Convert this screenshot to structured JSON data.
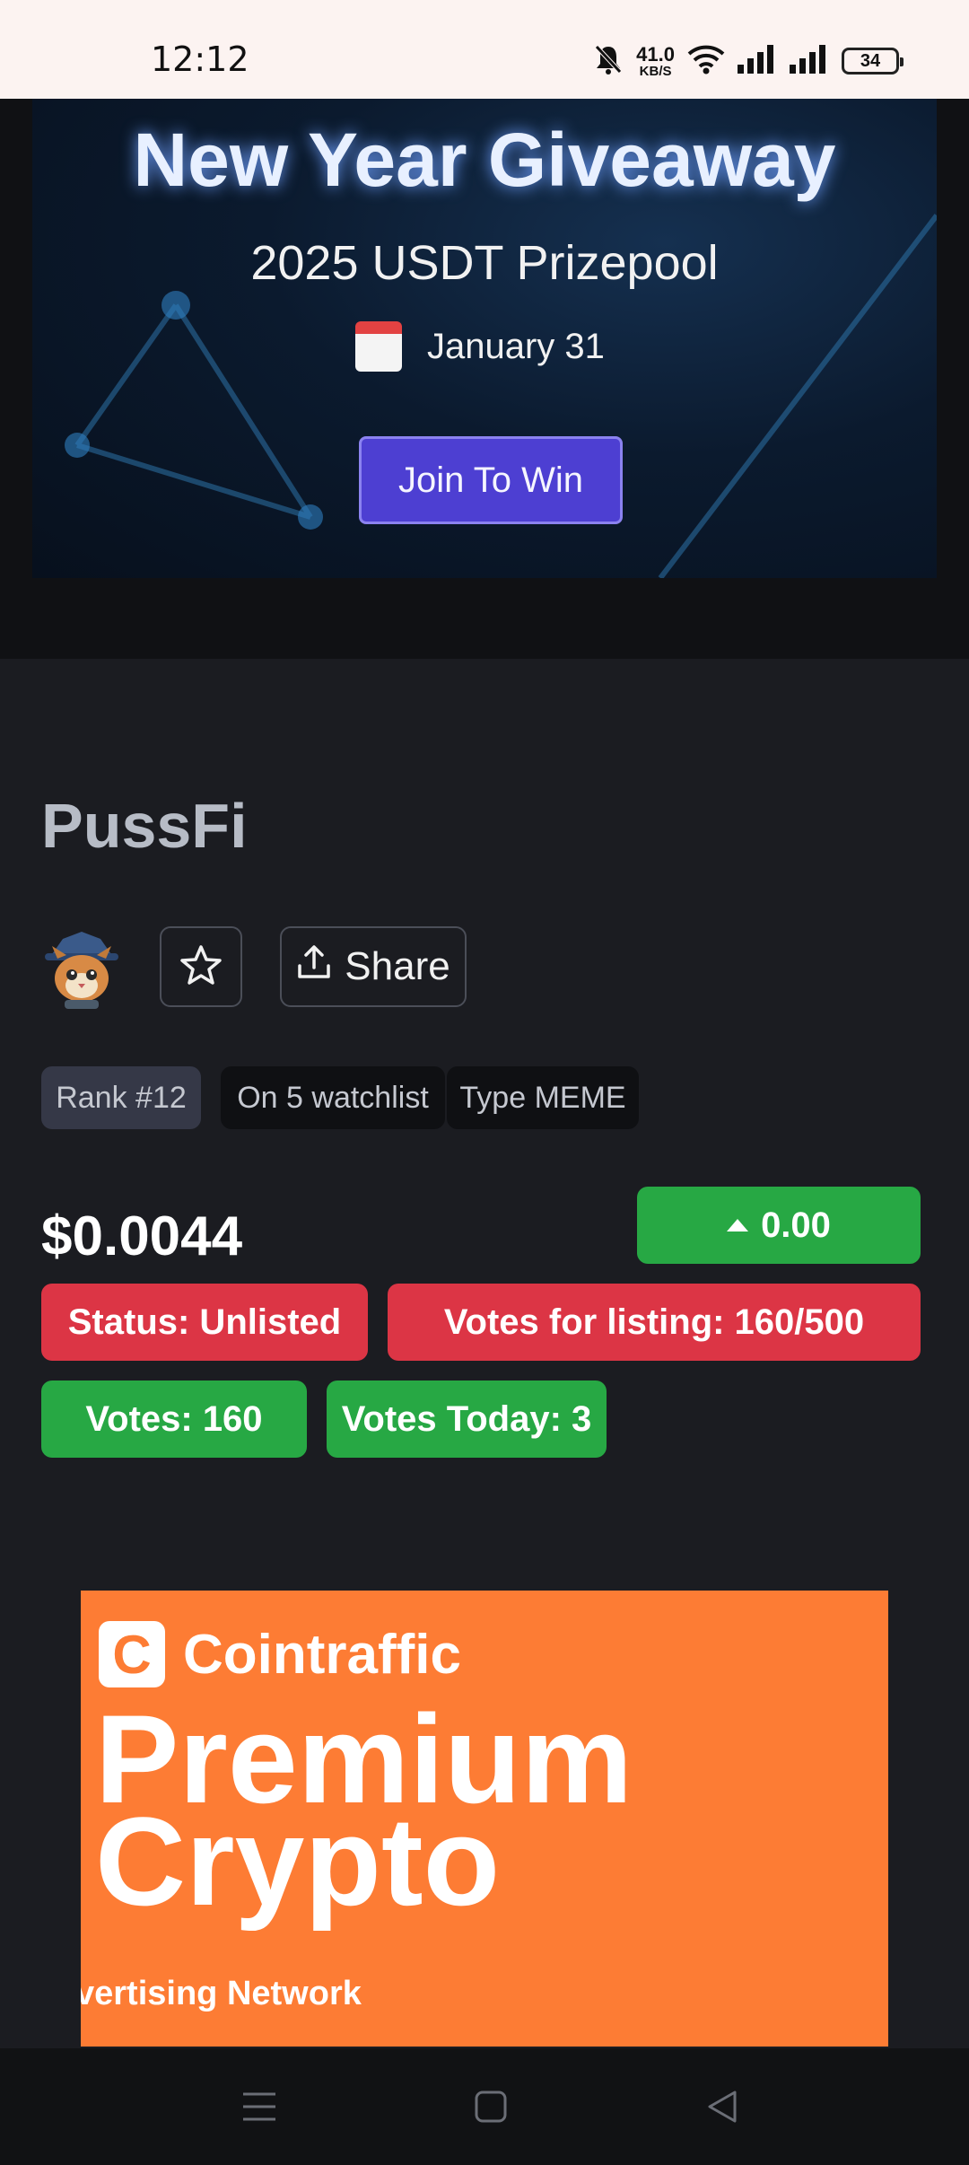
{
  "status_bar": {
    "time": "12:12",
    "net_speed": "41.0",
    "net_unit": "KB/S",
    "battery": "34"
  },
  "banner": {
    "title": "New Year Giveaway",
    "subtitle": "2025 USDT Prizepool",
    "date": "January 31",
    "button": "Join To Win"
  },
  "token": {
    "name": "PussFi",
    "share_label": "Share",
    "chips": {
      "rank": "Rank #12",
      "watchlist": "On 5 watchlist",
      "type": "Type MEME"
    },
    "price": "$0.0044",
    "change": "0.00",
    "status": "Status: Unlisted",
    "votes_listing": "Votes for listing: 160/500",
    "votes": "Votes: 160",
    "votes_today": "Votes Today: 3"
  },
  "ad": {
    "brand": "Cointraffic",
    "line1": "Premium",
    "line2": "Crypto",
    "tagline": "vertising Network"
  },
  "colors": {
    "green": "#27a844",
    "red": "#dc3545",
    "ad_orange": "#fd7c34",
    "banner_button": "#4d3fd2"
  },
  "icons": [
    "bell-muted-icon",
    "wifi-icon",
    "signal-icon",
    "battery-icon",
    "calendar-icon",
    "star-icon",
    "share-icon",
    "caret-up-icon",
    "menu-icon",
    "home-icon",
    "back-icon"
  ]
}
